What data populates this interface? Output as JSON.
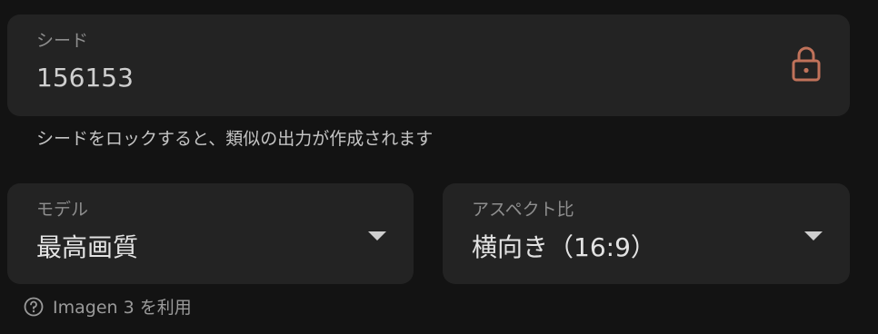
{
  "seed": {
    "label": "シード",
    "value": "156153",
    "lock_icon": "lock-icon",
    "lock_color": "#c0725a",
    "hint": "シードをロックすると、類似の出力が作成されます"
  },
  "model": {
    "label": "モデル",
    "value": "最高画質",
    "caret_icon": "caret-down-icon"
  },
  "aspect_ratio": {
    "label": "アスペクト比",
    "value": "横向き（16:9）",
    "caret_icon": "caret-down-icon"
  },
  "footnote": {
    "icon": "help-circle-icon",
    "text": "Imagen 3 を利用"
  }
}
